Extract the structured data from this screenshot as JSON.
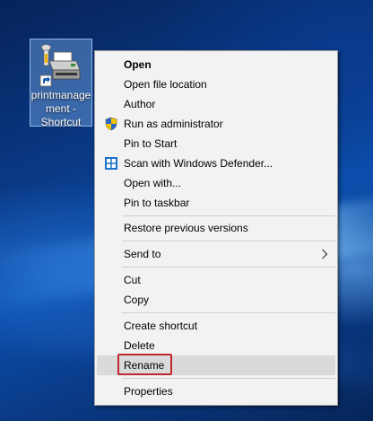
{
  "desktop": {
    "icon_label": "printmanage\nment -\nShortcut",
    "icon_name": "printer-shortcut-icon"
  },
  "context_menu": {
    "items": [
      {
        "label": "Open",
        "bold": true
      },
      {
        "label": "Open file location"
      },
      {
        "label": "Author"
      },
      {
        "label": "Run as administrator",
        "icon": "uac-shield-icon"
      },
      {
        "label": "Pin to Start"
      },
      {
        "label": "Scan with Windows Defender...",
        "icon": "windows-defender-icon"
      },
      {
        "label": "Open with..."
      },
      {
        "label": "Pin to taskbar"
      },
      {
        "label": "Restore previous versions"
      },
      {
        "label": "Send to",
        "submenu": true
      },
      {
        "label": "Cut"
      },
      {
        "label": "Copy"
      },
      {
        "label": "Create shortcut"
      },
      {
        "label": "Delete"
      },
      {
        "label": "Rename",
        "hovered": true,
        "highlighted": true
      },
      {
        "label": "Properties"
      }
    ]
  },
  "colors": {
    "highlight_border": "#c0282e",
    "menu_background": "#f2f2f2",
    "hover_background": "#dadada"
  }
}
